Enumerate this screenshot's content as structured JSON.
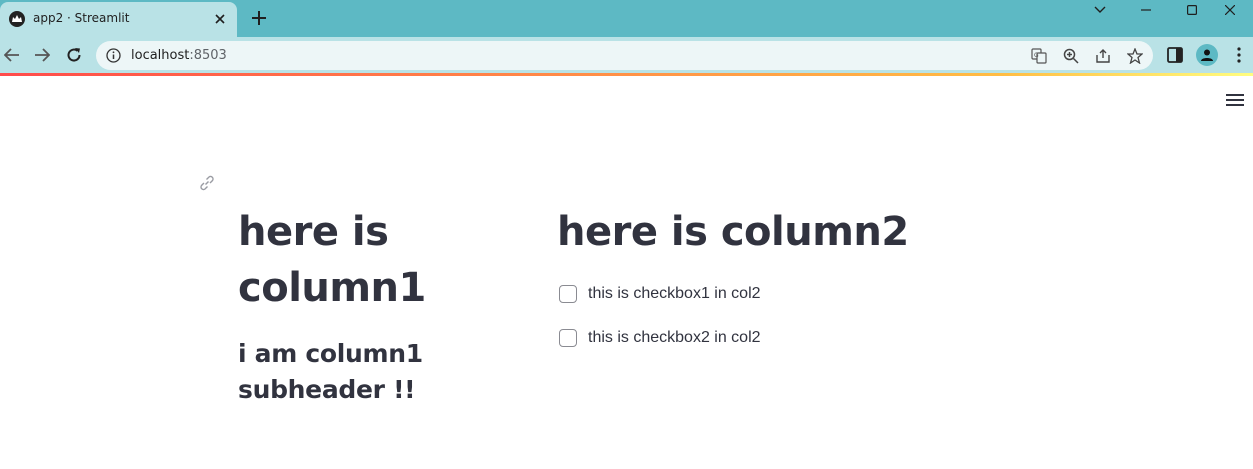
{
  "browser": {
    "tab": {
      "title": "app2 · Streamlit",
      "favicon": "streamlit-crown-icon"
    },
    "address": {
      "host": "localhost",
      "port": ":8503"
    },
    "colors": {
      "frame": "#5db9c4",
      "toolbar": "#b9e2e6"
    }
  },
  "app": {
    "col1": {
      "header": "here is column1",
      "subheader": "i am column1 subheader !!"
    },
    "col2": {
      "header": "here is column2",
      "checkboxes": [
        {
          "label": "this is checkbox1 in col2",
          "checked": false
        },
        {
          "label": "this is checkbox2 in col2",
          "checked": false
        }
      ]
    },
    "colors": {
      "text": "#31333f",
      "accent": "#ff4b4b"
    }
  }
}
